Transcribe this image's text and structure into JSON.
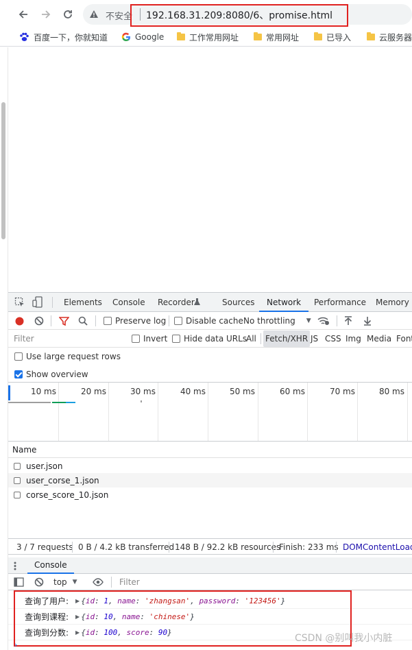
{
  "browser": {
    "security_label": "不安全",
    "url": "192.168.31.209:8080/6、promise.html",
    "bookmarks": [
      {
        "label": "百度一下，你就知道"
      },
      {
        "label": "Google"
      },
      {
        "label": "工作常用网址"
      },
      {
        "label": "常用网址"
      },
      {
        "label": "已导入"
      },
      {
        "label": "云服务器"
      }
    ]
  },
  "devtools": {
    "tabs": [
      "Elements",
      "Console",
      "Recorder",
      "Sources",
      "Network",
      "Performance",
      "Memory"
    ],
    "active_tab": "Network",
    "network_toolbar": {
      "preserve_log": "Preserve log",
      "disable_cache": "Disable cache",
      "throttling": "No throttling"
    },
    "filter_row": {
      "placeholder": "Filter",
      "invert": "Invert",
      "hide_data_urls": "Hide data URLs",
      "types": [
        "All",
        "Fetch/XHR",
        "JS",
        "CSS",
        "Img",
        "Media",
        "Font"
      ],
      "selected_type": "Fetch/XHR"
    },
    "options": {
      "large_rows": "Use large request rows",
      "large_rows_checked": false,
      "show_overview": "Show overview",
      "show_overview_checked": true
    },
    "overview_ticks": [
      "10 ms",
      "20 ms",
      "30 ms",
      "40 ms",
      "50 ms",
      "60 ms",
      "70 ms",
      "80 ms"
    ],
    "table": {
      "column_name": "Name",
      "rows": [
        "user.json",
        "user_corse_1.json",
        "corse_score_10.json"
      ]
    },
    "summary": {
      "requests": "3 / 7 requests",
      "transferred": "0 B / 4.2 kB transferred",
      "resources": "148 B / 92.2 kB resources",
      "finish": "Finish: 233 ms",
      "dom_loaded": "DOMContentLoaded"
    },
    "console": {
      "tab_label": "Console",
      "context": "top",
      "filter_placeholder": "Filter",
      "lines": [
        {
          "label": "查询了用户:",
          "open": "{",
          "pairs": [
            {
              "key": "id",
              "value": "1",
              "type": "n"
            },
            {
              "key": "name",
              "value": "'zhangsan'",
              "type": "s"
            },
            {
              "key": "password",
              "value": "'123456'",
              "type": "s"
            }
          ],
          "close": "}"
        },
        {
          "label": "查询到课程:",
          "open": "{",
          "pairs": [
            {
              "key": "id",
              "value": "10",
              "type": "n"
            },
            {
              "key": "name",
              "value": "'chinese'",
              "type": "s"
            }
          ],
          "close": "}"
        },
        {
          "label": "查询到分数:",
          "open": "{",
          "pairs": [
            {
              "key": "id",
              "value": "100",
              "type": "n"
            },
            {
              "key": "score",
              "value": "90",
              "type": "n"
            }
          ],
          "close": "}"
        }
      ]
    }
  },
  "watermark": "CSDN @别叫我小内脏",
  "colors": {
    "accent": "#1a73e8",
    "highlight": "#e0211f",
    "record": "#d93025"
  }
}
